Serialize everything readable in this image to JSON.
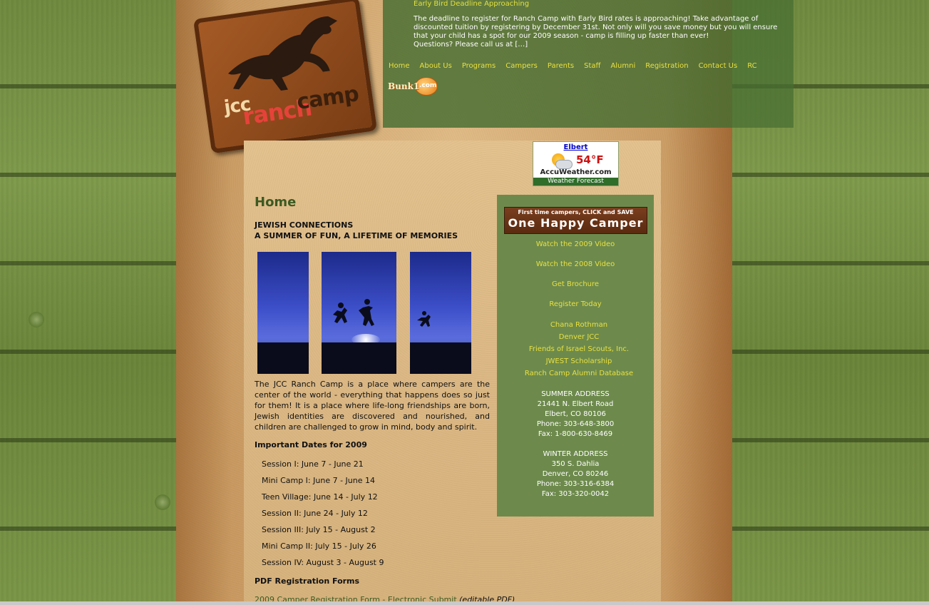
{
  "news": {
    "title": "Early Bird Deadline Approaching",
    "body": "The deadline to register for Ranch Camp with Early Bird rates is approaching! Take advantage of discounted tuition by registering by December 31st. Not only will you save money but you will ensure that your child has a spot for our 2009 season - camp is filling up faster than ever!",
    "more": "Questions? Please call us at […]"
  },
  "logo": {
    "jcc": "jcc",
    "ranch": "ranch",
    "camp": "camp"
  },
  "nav": [
    "Home",
    "About Us",
    "Programs",
    "Campers",
    "Parents",
    "Staff",
    "Alumni",
    "Registration",
    "Contact Us",
    "RC"
  ],
  "bunk1": {
    "text": "Bunk1",
    "com": ".com"
  },
  "weather": {
    "city": "Elbert",
    "temp": "54°F",
    "brand": "AccuWeather.com",
    "label": "Weather Forecast"
  },
  "main": {
    "title": "Home",
    "tagline1": "JEWISH CONNECTIONS",
    "tagline2": "A SUMMER OF FUN, A LIFETIME OF MEMORIES",
    "intro": "The JCC Ranch Camp is a place where campers are the center of the world - everything that happens does so just for them! It is a place where life-long friendships are born, Jewish identities are discovered and nourished, and children are challenged to grow in mind, body and spirit.",
    "dates_title": "Important Dates for 2009",
    "sessions": [
      "Session I: June 7 - June 21",
      "Mini Camp I: June 7 - June 14",
      "Teen Village: June 14 - July 12",
      "Session II: June 24 - July 12",
      "Session III: July 15 - August 2",
      "Mini Camp II: July 15 - July 26",
      "Session IV: August 3 - August 9"
    ],
    "pdf_title": "PDF Registration Forms",
    "pdf_link": "2009 Camper Registration Form - Electronic Submit",
    "pdf_note": "(editable PDF)"
  },
  "sidebar": {
    "promo_line1": "First time campers, CLICK and SAVE",
    "promo_line2": "One Happy Camper",
    "links": [
      "Watch the 2009 Video",
      "Watch the 2008 Video",
      "Get Brochure",
      "Register Today"
    ],
    "partners": [
      "Chana Rothman",
      "Denver JCC",
      "Friends of Israel Scouts, Inc.",
      "JWEST Scholarship",
      "Ranch Camp Alumni Database"
    ],
    "summer": [
      "SUMMER ADDRESS",
      "21441 N. Elbert Road",
      "Elbert, CO 80106",
      "Phone: 303-648-3800",
      "Fax: 1-800-630-8469"
    ],
    "winter": [
      "WINTER ADDRESS",
      "350 S. Dahlia",
      "Denver, CO 80246",
      "Phone: 303-316-6384",
      "Fax: 303-320-0042"
    ]
  }
}
